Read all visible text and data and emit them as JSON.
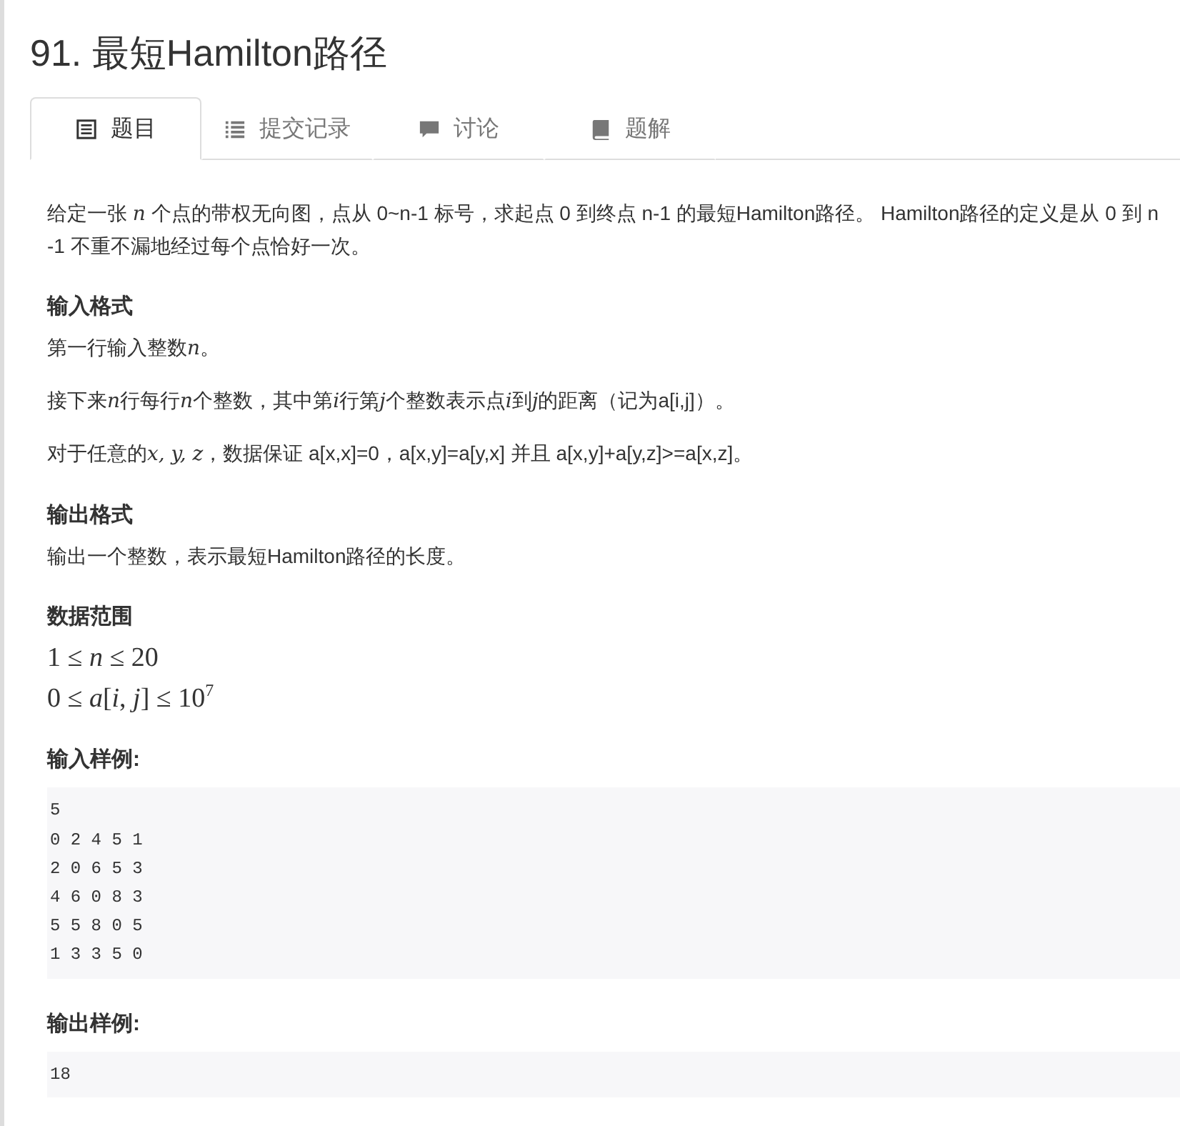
{
  "title": "91. 最短Hamilton路径",
  "tabs": [
    {
      "label": "题目",
      "kind": "doc",
      "selected": true
    },
    {
      "label": "提交记录",
      "kind": "list",
      "selected": false
    },
    {
      "label": "讨论",
      "kind": "chat",
      "selected": false
    },
    {
      "label": "题解",
      "kind": "book",
      "selected": false
    }
  ],
  "blocks": [
    {
      "kind": "paragraph",
      "parts": [
        {
          "kind": "text",
          "text": "给定一张 "
        },
        {
          "kind": "math",
          "text": "n"
        },
        {
          "kind": "text",
          "text": " 个点的带权无向图，点从 0~n-1 标号，求起点 0 到终点 n-1 的最短Hamilton路径。 Hamilton路径的定义是从 0 到 n-1 不重不漏地经过每个点恰好一次。"
        }
      ]
    },
    {
      "kind": "heading",
      "text": "输入格式"
    },
    {
      "kind": "paragraph",
      "parts": [
        {
          "kind": "text",
          "text": "第一行输入整数"
        },
        {
          "kind": "math",
          "text": "n"
        },
        {
          "kind": "text",
          "text": "。"
        }
      ]
    },
    {
      "kind": "paragraph",
      "parts": [
        {
          "kind": "text",
          "text": "接下来"
        },
        {
          "kind": "math",
          "text": "n"
        },
        {
          "kind": "text",
          "text": "行每行"
        },
        {
          "kind": "math",
          "text": "n"
        },
        {
          "kind": "text",
          "text": "个整数，其中第"
        },
        {
          "kind": "math",
          "text": "i"
        },
        {
          "kind": "text",
          "text": "行第"
        },
        {
          "kind": "math",
          "text": "j"
        },
        {
          "kind": "text",
          "text": "个整数表示点"
        },
        {
          "kind": "math",
          "text": "i"
        },
        {
          "kind": "text",
          "text": "到"
        },
        {
          "kind": "math",
          "text": "j"
        },
        {
          "kind": "text",
          "text": "的距离（记为a[i,j]）。"
        }
      ]
    },
    {
      "kind": "paragraph",
      "parts": [
        {
          "kind": "text",
          "text": "对于任意的"
        },
        {
          "kind": "math",
          "text": "x, y, z"
        },
        {
          "kind": "text",
          "text": "，数据保证 a[x,x]=0，a[x,y]=a[y,x] 并且 a[x,y]+a[y,z]>=a[x,z]。"
        }
      ]
    },
    {
      "kind": "heading",
      "text": "输出格式"
    },
    {
      "kind": "paragraph",
      "parts": [
        {
          "kind": "text",
          "text": "输出一个整数，表示最短Hamilton路径的长度。"
        }
      ]
    },
    {
      "kind": "heading",
      "text": "数据范围"
    },
    {
      "kind": "math",
      "lines": [
        "1 ≤ *n* ≤ 20",
        "0 ≤ *a*[*i*, *j*] ≤ 10$^{7}$"
      ]
    },
    {
      "kind": "heading",
      "text": "输入样例:"
    },
    {
      "kind": "code",
      "text": "5\n0 2 4 5 1\n2 0 6 5 3\n4 6 0 8 3\n5 5 8 0 5\n1 3 3 5 0"
    },
    {
      "kind": "heading",
      "text": "输出样例:"
    },
    {
      "kind": "code",
      "text": "18"
    }
  ]
}
